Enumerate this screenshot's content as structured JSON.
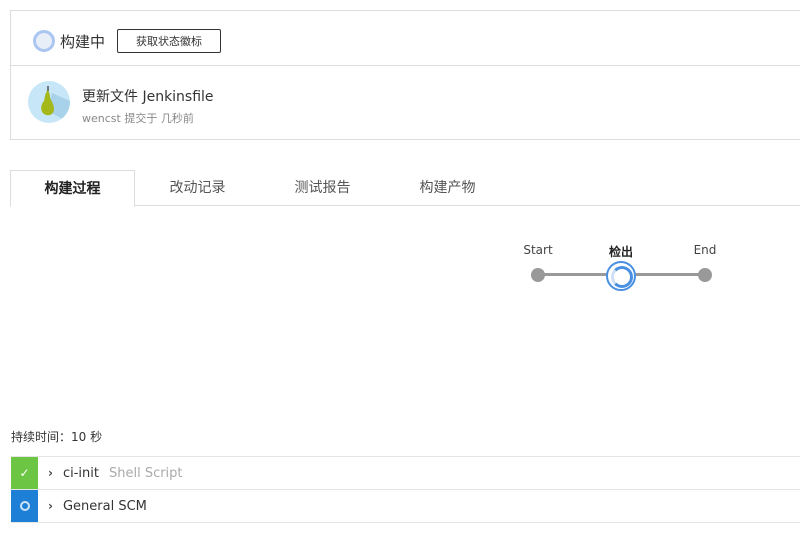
{
  "header": {
    "status_text": "构建中",
    "badge_button": "获取状态徽标"
  },
  "commit": {
    "title": "更新文件 Jenkinsfile",
    "subtitle": "wencst 提交于 几秒前"
  },
  "tabs": [
    {
      "label": "构建过程",
      "active": true
    },
    {
      "label": "改动记录"
    },
    {
      "label": "测试报告"
    },
    {
      "label": "构建产物"
    }
  ],
  "pipeline": {
    "stages": [
      {
        "label": "Start",
        "state": "done"
      },
      {
        "label": "检出",
        "state": "running"
      },
      {
        "label": "End",
        "state": "pending"
      }
    ]
  },
  "duration": "持续时间：10 秒",
  "steps": [
    {
      "name": "ci-init",
      "type": "Shell Script",
      "status": "success",
      "color": "#6cc644"
    },
    {
      "name": "General SCM",
      "type": "",
      "status": "running",
      "color": "#1e7fd6"
    }
  ]
}
